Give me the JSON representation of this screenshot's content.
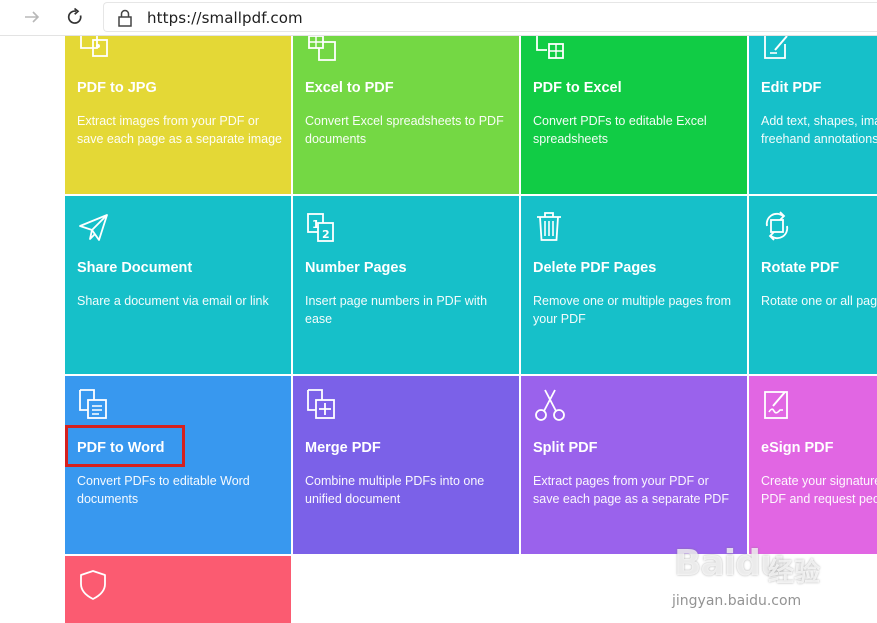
{
  "browser": {
    "url": "https://smallpdf.com"
  },
  "tiles": [
    {
      "title": "PDF to JPG",
      "desc": "Extract images from your PDF or save each page as a separate image",
      "color": "#e4d836",
      "icon": "jpg-image-icon"
    },
    {
      "title": "Excel to PDF",
      "desc": "Convert Excel spreadsheets to PDF documents",
      "color": "#74d844",
      "icon": "excel-sheet-icon"
    },
    {
      "title": "PDF to Excel",
      "desc": "Convert PDFs to editable Excel spreadsheets",
      "color": "#11cc45",
      "icon": "pdf-excel-icon"
    },
    {
      "title": "Edit PDF",
      "desc": "Add text, shapes, images and freehand annotations",
      "color": "#16c0c9",
      "icon": "edit-pen-icon"
    },
    {
      "title": "Share Document",
      "desc": "Share a document via email or link",
      "color": "#16c0c9",
      "icon": "paper-plane-icon"
    },
    {
      "title": "Number Pages",
      "desc": "Insert page numbers in PDF with ease",
      "color": "#16c0c9",
      "icon": "page-numbers-icon"
    },
    {
      "title": "Delete PDF Pages",
      "desc": "Remove one or multiple pages from your PDF",
      "color": "#16c0c9",
      "icon": "trash-icon"
    },
    {
      "title": "Rotate PDF",
      "desc": "Rotate one or all pages",
      "color": "#16c0c9",
      "icon": "rotate-icon"
    },
    {
      "title": "PDF to Word",
      "desc": "Convert PDFs to editable Word documents",
      "color": "#3898ef",
      "icon": "pdf-word-icon"
    },
    {
      "title": "Merge PDF",
      "desc": "Combine multiple PDFs into one unified document",
      "color": "#7b61e8",
      "icon": "merge-plus-icon"
    },
    {
      "title": "Split PDF",
      "desc": "Extract pages from your PDF or save each page as a separate PDF",
      "color": "#9a62ec",
      "icon": "scissors-icon"
    },
    {
      "title": "eSign PDF",
      "desc": "Create your signature, sign your PDF and request people to sign",
      "color": "#e166e3",
      "icon": "esign-icon"
    },
    {
      "title": "",
      "desc": "",
      "color": "#fb5b71",
      "icon": "shield-icon"
    }
  ],
  "highlight": {
    "color": "#d5201f",
    "target": "PDF to Word"
  },
  "watermark": {
    "brand": "Baidu",
    "product": "经验",
    "url": "jingyan.baidu.com"
  }
}
